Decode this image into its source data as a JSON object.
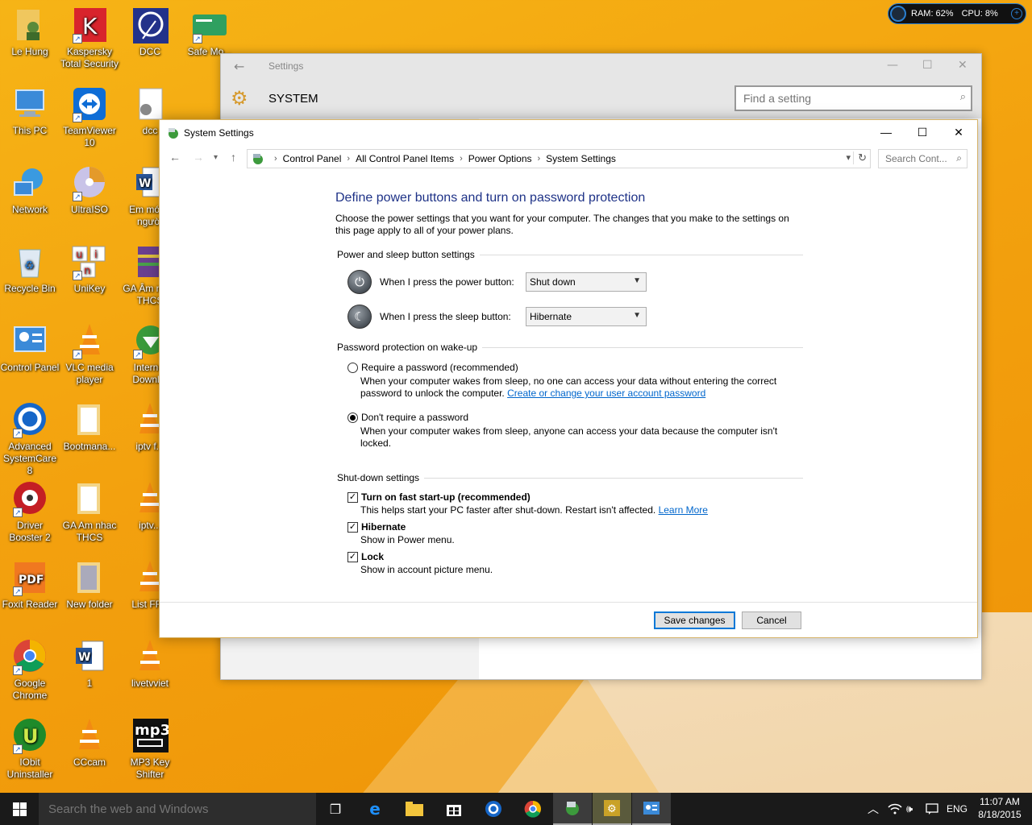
{
  "desktop": {
    "icons": [
      {
        "label": "Le Hung"
      },
      {
        "label": "Kaspersky Total Security"
      },
      {
        "label": "DCC"
      },
      {
        "label": "Safe Mo..."
      },
      {
        "label": "This PC"
      },
      {
        "label": "TeamViewer 10"
      },
      {
        "label": "dcc"
      },
      {
        "label": "Network"
      },
      {
        "label": "UltraISO"
      },
      {
        "label": "Em mới 1 người"
      },
      {
        "label": "Recycle Bin"
      },
      {
        "label": "UniKey"
      },
      {
        "label": "GA Âm nhạc THCS"
      },
      {
        "label": "Control Panel"
      },
      {
        "label": "VLC media player"
      },
      {
        "label": "Internet Downl..."
      },
      {
        "label": "Advanced SystemCare 8"
      },
      {
        "label": "Bootmana..."
      },
      {
        "label": "iptv f..."
      },
      {
        "label": "Driver Booster 2"
      },
      {
        "label": "GA Am nhac THCS"
      },
      {
        "label": "iptv..."
      },
      {
        "label": "Foxit Reader"
      },
      {
        "label": "New folder"
      },
      {
        "label": "List FF..."
      },
      {
        "label": "Google Chrome"
      },
      {
        "label": "1"
      },
      {
        "label": "livetvviet"
      },
      {
        "label": "IObit Uninstaller"
      },
      {
        "label": "CCcam"
      },
      {
        "label": "MP3 Key Shifter"
      }
    ]
  },
  "hud": {
    "ram": "RAM: 62%",
    "cpu": "CPU: 8%"
  },
  "settings_window": {
    "title": "Settings",
    "section": "SYSTEM",
    "search_placeholder": "Find a setting"
  },
  "dialog": {
    "title": "System Settings",
    "breadcrumbs": [
      "Control Panel",
      "All Control Panel Items",
      "Power Options",
      "System Settings"
    ],
    "search_placeholder": "Search Cont...",
    "heading": "Define power buttons and turn on password protection",
    "intro_line1": "Choose the power settings that you want for your computer. The changes that you make to the settings on",
    "intro_line2": "this page apply to all of your power plans.",
    "power_group": "Power and sleep button settings",
    "power_button_label": "When I press the power button:",
    "power_button_value": "Shut down",
    "sleep_button_label": "When I press the sleep button:",
    "sleep_button_value": "Hibernate",
    "password_group": "Password protection on wake-up",
    "require_label": "Require a password (recommended)",
    "require_desc1": "When your computer wakes from sleep, no one can access your data without entering the correct",
    "require_desc2": "password to unlock the computer.",
    "require_link": "Create or change your user account password",
    "norequire_label": "Don't require a password",
    "norequire_desc1": "When your computer wakes from sleep, anyone can access your data because the computer isn't",
    "norequire_desc2": "locked.",
    "shutdown_group": "Shut-down settings",
    "fast_label": "Turn on fast start-up (recommended)",
    "fast_desc": "This helps start your PC faster after shut-down. Restart isn't affected.",
    "fast_link": "Learn More",
    "hibernate_label": "Hibernate",
    "hibernate_desc": "Show in Power menu.",
    "lock_label": "Lock",
    "lock_desc": "Show in account picture menu.",
    "save_label": "Save changes",
    "cancel_label": "Cancel"
  },
  "taskbar": {
    "search_placeholder": "Search the web and Windows",
    "lang": "ENG",
    "time": "11:07 AM",
    "date": "8/18/2015"
  }
}
